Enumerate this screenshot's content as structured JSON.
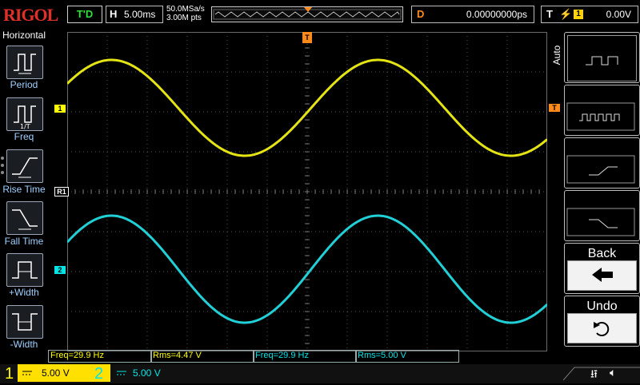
{
  "header": {
    "brand": "RIGOL",
    "run_status": "T'D",
    "horizontal_key": "H",
    "timebase": "5.00ms",
    "sample_rate": "50.0MSa/s",
    "mem_depth": "3.00M pts",
    "delay_key": "D",
    "delay_value": "0.00000000ps",
    "trigger_key": "T",
    "trigger_source": "1",
    "trigger_level": "0.00V"
  },
  "left_menu": {
    "title": "Horizontal",
    "items": [
      {
        "label": "Period",
        "icon": "period-icon"
      },
      {
        "label": "Freq",
        "icon": "freq-icon"
      },
      {
        "label": "Rise Time",
        "icon": "rise-time-icon"
      },
      {
        "label": "Fall Time",
        "icon": "fall-time-icon"
      },
      {
        "label": "+Width",
        "icon": "positive-width-icon"
      },
      {
        "label": "-Width",
        "icon": "negative-width-icon"
      }
    ]
  },
  "right_menu": {
    "title": "Auto",
    "back_label": "Back",
    "undo_label": "Undo"
  },
  "markers": {
    "trigger_top": "T",
    "trigger_right": "T",
    "ch1": "1",
    "ch2": "2",
    "ref": "R1"
  },
  "measurements": [
    {
      "text": "Freq=29.9 Hz",
      "color": "#ffff00"
    },
    {
      "text": "Rms=4.47 V",
      "color": "#ffff00"
    },
    {
      "text": "Freq=29.9 Hz",
      "color": "#00e5e5"
    },
    {
      "text": "Rms=5.00 V",
      "color": "#00e5e5"
    }
  ],
  "channels": [
    {
      "num": "1",
      "scale": "5.00 V",
      "color": "#ffff00"
    },
    {
      "num": "2",
      "scale": "5.00 V",
      "color": "#00e5e5"
    }
  ],
  "colors": {
    "ch1": "#e4e414",
    "ch2": "#21d0d6",
    "accent_orange": "#ff8a1c",
    "menu_blue": "#9fd0ff"
  }
}
